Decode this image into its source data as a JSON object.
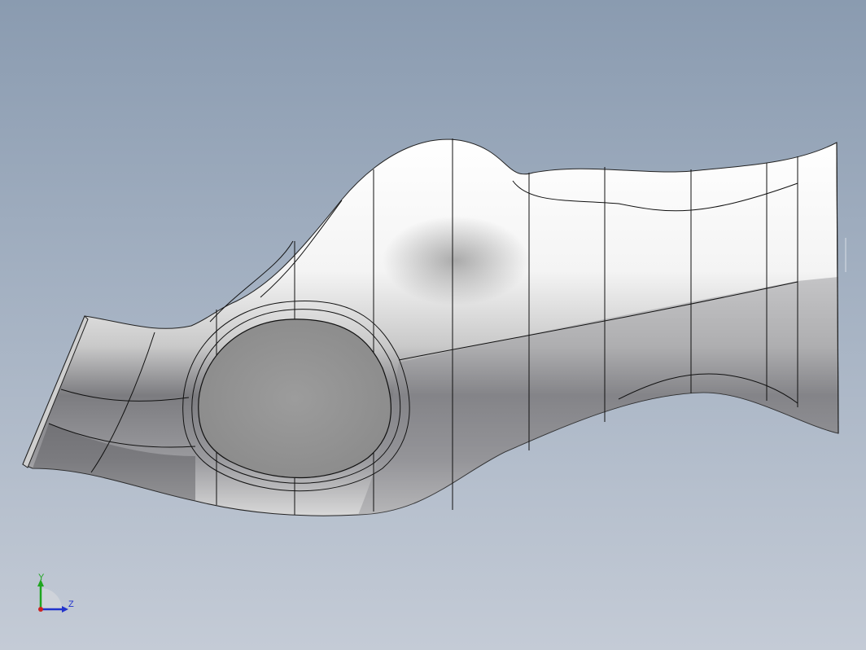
{
  "viewport": {
    "background_top": "#8a9bb0",
    "background_bottom": "#c4cbd6"
  },
  "model": {
    "icon": "lofted-duct-surface",
    "face_color": "#e6e6e6",
    "opening_color": "#9a9a9a",
    "edge_color": "#111111"
  },
  "triad": {
    "y_label": "Y",
    "z_label": "Z",
    "y_color": "#1fa51f",
    "z_color": "#2233cc",
    "x_color": "#cc2222"
  }
}
